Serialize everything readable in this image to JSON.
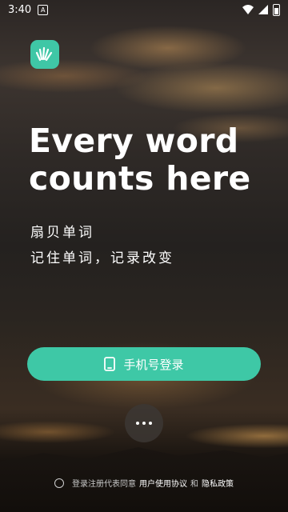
{
  "status_bar": {
    "time": "3:40",
    "notification_letter": "A"
  },
  "app": {
    "logo_icon": "fan-shell-logo-icon",
    "brand_color": "#3ec8a6"
  },
  "hero": {
    "headline_line1": "Every word",
    "headline_line2": "counts here",
    "subtitle_line1": "扇贝单词",
    "subtitle_line2": "记住单词，记录改变"
  },
  "actions": {
    "phone_login_label": "手机号登录",
    "phone_icon": "phone-icon",
    "more_icon": "more-dots-icon"
  },
  "agreement": {
    "prefix": "登录注册代表同意",
    "user_agreement": "用户使用协议",
    "and": "和",
    "privacy_policy": "隐私政策"
  }
}
